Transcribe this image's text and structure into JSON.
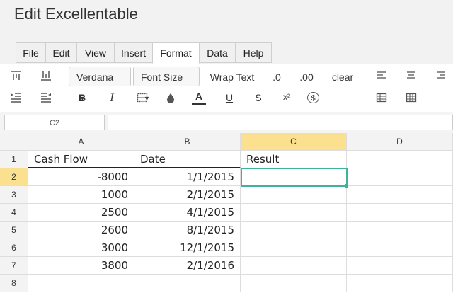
{
  "app": {
    "title": "Edit Excellentable"
  },
  "menu": {
    "tabs": [
      "File",
      "Edit",
      "View",
      "Insert",
      "Format",
      "Data",
      "Help"
    ],
    "active": "Format"
  },
  "toolbar": {
    "font_family": "Verdana",
    "font_size": "Font Size",
    "wrap_text": "Wrap Text",
    "dec_less": ".0",
    "dec_more": ".00",
    "clear": "clear",
    "bold": "B",
    "italic": "I",
    "text_color": "A",
    "underline": "U",
    "strike": "S",
    "superscript": "x²",
    "currency": "$"
  },
  "formula_bar": {
    "cell_ref": "C2",
    "value": ""
  },
  "columns": [
    "A",
    "B",
    "C",
    "D"
  ],
  "rows": [
    {
      "n": "1",
      "a": "Cash Flow",
      "b": "Date",
      "c": "Result"
    },
    {
      "n": "2",
      "a": "-8000",
      "b": "1/1/2015",
      "c": ""
    },
    {
      "n": "3",
      "a": "1000",
      "b": "2/1/2015",
      "c": ""
    },
    {
      "n": "4",
      "a": "2500",
      "b": "4/1/2015",
      "c": ""
    },
    {
      "n": "5",
      "a": "2600",
      "b": "8/1/2015",
      "c": ""
    },
    {
      "n": "6",
      "a": "3000",
      "b": "12/1/2015",
      "c": ""
    },
    {
      "n": "7",
      "a": "3800",
      "b": "2/1/2016",
      "c": ""
    },
    {
      "n": "8",
      "a": "",
      "b": "",
      "c": ""
    }
  ],
  "colors": {
    "selection": "#3fb39a",
    "selected_header": "#fbe08f"
  }
}
